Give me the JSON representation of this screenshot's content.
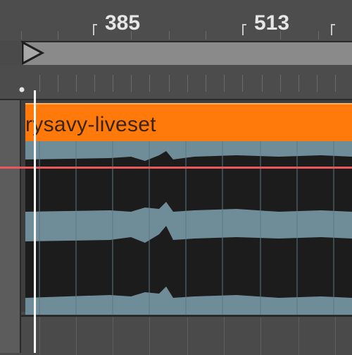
{
  "ruler": {
    "bar_labels": [
      "385",
      "513"
    ]
  },
  "clip": {
    "name": "rysavy-liveset",
    "color": "#ff7a0a",
    "waveform_color": "#6f8c99"
  },
  "automation": {
    "line_color": "#e85a5a"
  },
  "playhead": {
    "color": "#ffffff"
  }
}
